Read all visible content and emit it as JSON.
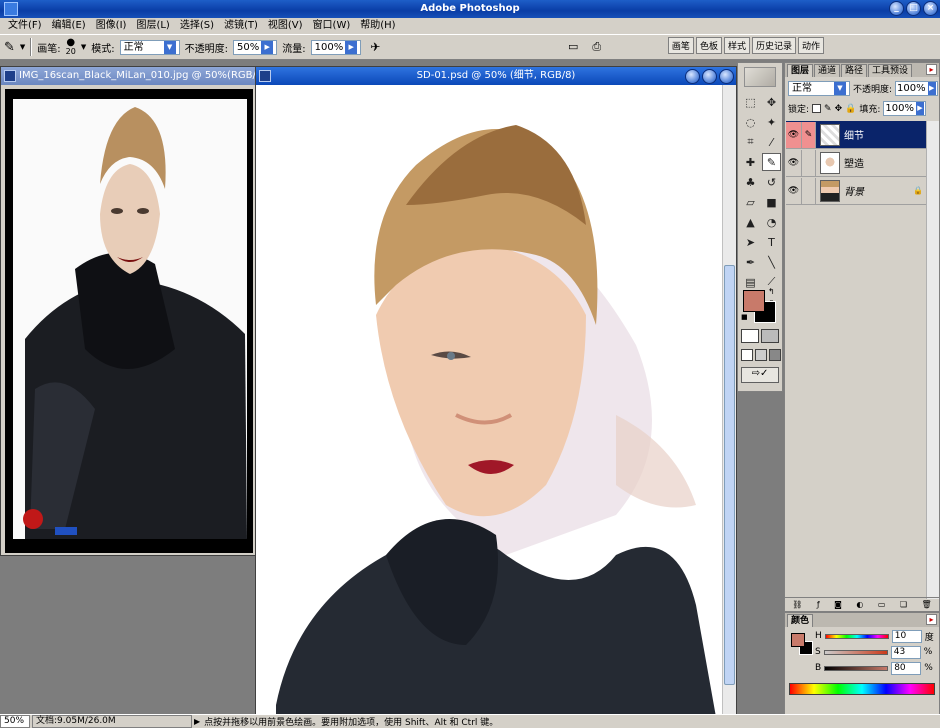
{
  "app": {
    "title": "Adobe Photoshop",
    "window_buttons": [
      "_",
      "□",
      "×"
    ]
  },
  "menu": [
    "文件(F)",
    "编辑(E)",
    "图像(I)",
    "图层(L)",
    "选择(S)",
    "滤镜(T)",
    "视图(V)",
    "窗口(W)",
    "帮助(H)"
  ],
  "options": {
    "brush_label": "画笔:",
    "brush_size": "20",
    "mode_label": "模式:",
    "mode_value": "正常",
    "opacity_label": "不透明度:",
    "opacity_value": "50%",
    "flow_label": "流量:",
    "flow_value": "100%"
  },
  "palette_well": [
    "画笔",
    "色板",
    "样式",
    "历史记录",
    "动作"
  ],
  "docs": [
    {
      "title": "IMG_16scan_Black_MiLan_010.jpg @ 50%(RGB/8)",
      "active": false
    },
    {
      "title": "SD-01.psd @ 50% (细节, RGB/8)",
      "active": true
    }
  ],
  "layers_panel": {
    "tabs": [
      "图层",
      "通道",
      "路径",
      "工具预设"
    ],
    "blend_mode": "正常",
    "opacity_label": "不透明度:",
    "opacity_value": "100%",
    "lock_label": "锁定:",
    "fill_label": "填充:",
    "fill_value": "100%",
    "layers": [
      {
        "name": "细节",
        "selected": true
      },
      {
        "name": "塑造",
        "selected": false
      },
      {
        "name": "背景",
        "selected": false
      }
    ],
    "footer_icons": [
      "link-icon",
      "fx-icon",
      "mask-icon",
      "adjustment-icon",
      "folder-icon",
      "new-layer-icon",
      "trash-icon"
    ]
  },
  "color_panel": {
    "title": "颜色",
    "channels": [
      {
        "label": "H",
        "value": "10",
        "unit": "度"
      },
      {
        "label": "S",
        "value": "43",
        "unit": "%"
      },
      {
        "label": "B",
        "value": "80",
        "unit": "%"
      }
    ],
    "foreground": "#c87a6a",
    "background": "#000000"
  },
  "status": {
    "zoom": "50%",
    "doc_size": "文档:9.05M/26.0M",
    "hint": "点按并拖移以用前景色绘画。要用附加选项，使用 Shift、Alt 和 Ctrl 键。"
  }
}
